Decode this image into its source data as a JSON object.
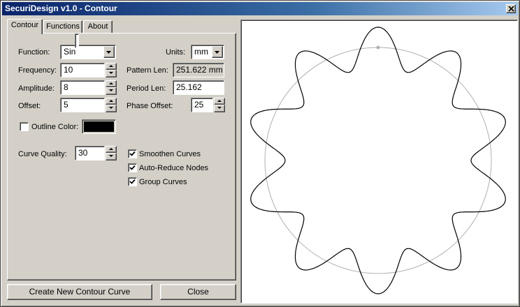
{
  "window": {
    "title": "SecuriDesign v1.0 - Contour"
  },
  "tabs": [
    {
      "label": "Contour",
      "active": true
    },
    {
      "label": "Functions",
      "active": false
    },
    {
      "label": "About",
      "active": false
    }
  ],
  "form": {
    "function_label": "Function:",
    "function_value": "Sin",
    "frequency_label": "Frequency:",
    "frequency_value": "10",
    "amplitude_label": "Amplitude:",
    "amplitude_value": "8",
    "offset_label": "Offset:",
    "offset_value": "5",
    "units_label": "Units:",
    "units_value": "mm",
    "pattern_len_label": "Pattern Len:",
    "pattern_len_value": "251.622 mm",
    "period_len_label": "Period Len:",
    "period_len_value": "25.162",
    "phase_offset_label": "Phase Offset:",
    "phase_offset_value": "25",
    "outline_color_label": "Outline Color:",
    "outline_color_checked": false,
    "outline_color_value": "#000000",
    "curve_quality_label": "Curve Quality:",
    "curve_quality_value": "30"
  },
  "options": [
    {
      "label": "Smoothen Curves",
      "checked": true
    },
    {
      "label": "Auto-Reduce Nodes",
      "checked": true
    },
    {
      "label": "Group Curves",
      "checked": true
    }
  ],
  "buttons": {
    "create_label": "Create New Contour Curve",
    "close_label": "Close"
  },
  "colors": {
    "title_start": "#0a246a",
    "title_end": "#a6caf0",
    "face": "#d4d0c8",
    "base_circle": "#b0b0b0",
    "contour": "#000000"
  }
}
